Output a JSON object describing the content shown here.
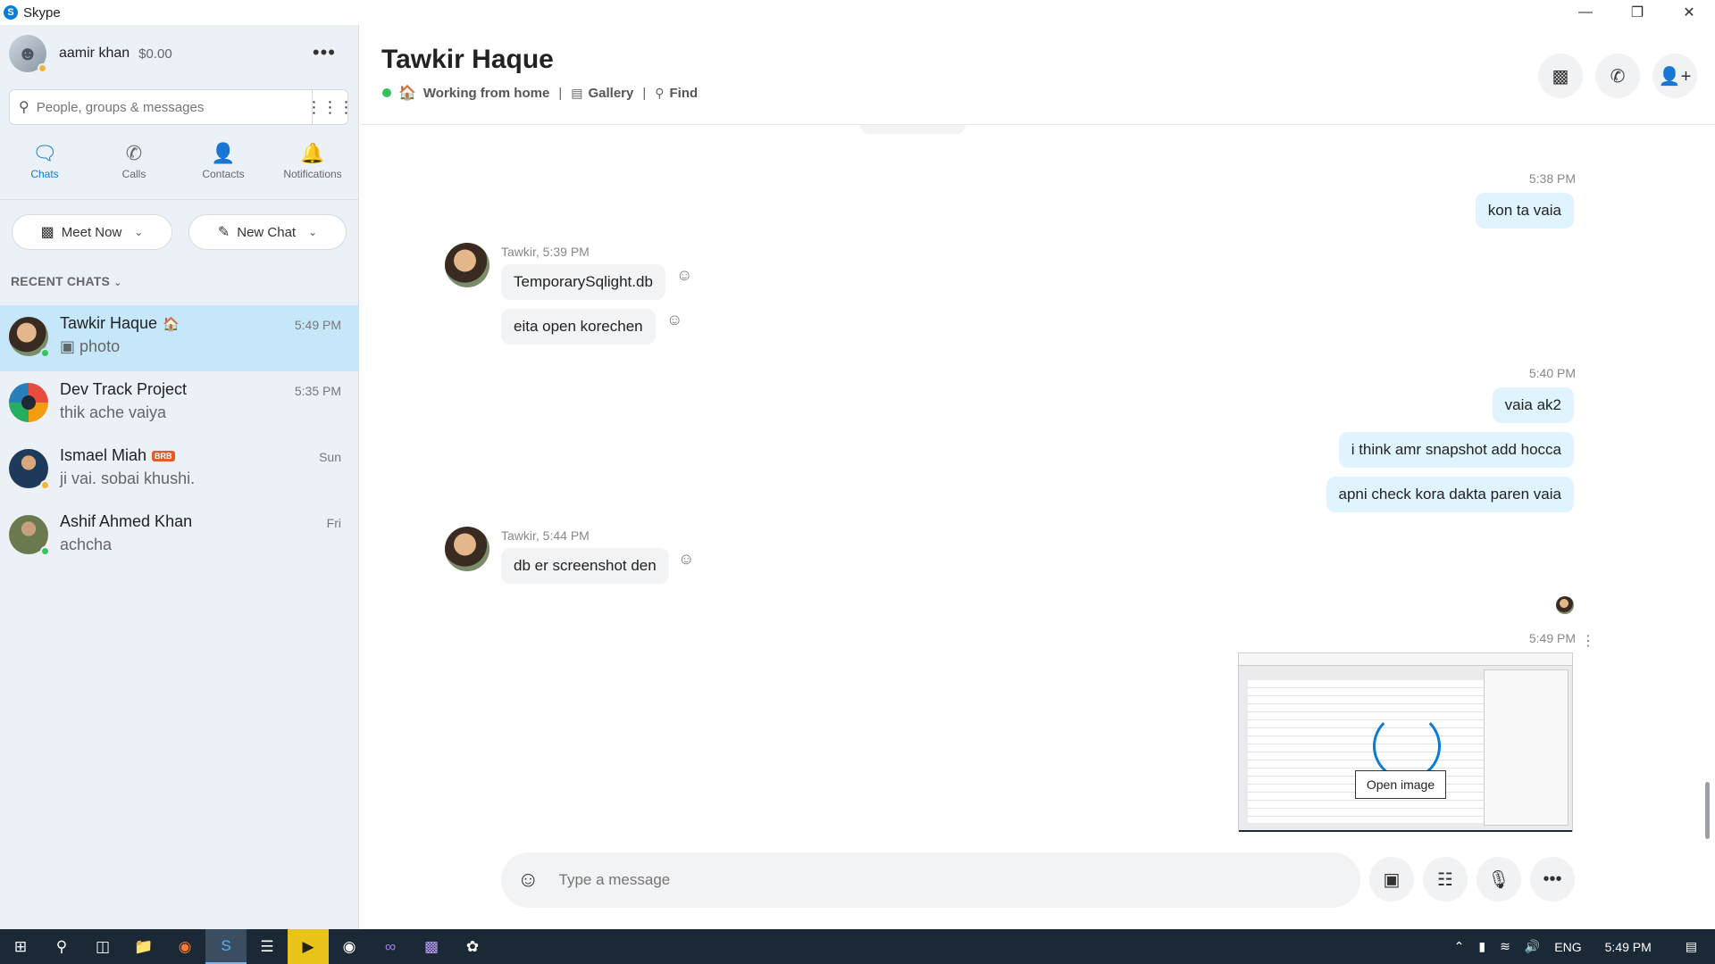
{
  "window": {
    "title": "Skype"
  },
  "profile": {
    "name": "aamir khan",
    "credit": "$0.00"
  },
  "search": {
    "placeholder": "People, groups & messages"
  },
  "nav": {
    "tabs": [
      {
        "label": "Chats",
        "icon": "chat-icon",
        "active": true
      },
      {
        "label": "Calls",
        "icon": "phone-icon"
      },
      {
        "label": "Contacts",
        "icon": "contacts-icon"
      },
      {
        "label": "Notifications",
        "icon": "bell-icon"
      }
    ]
  },
  "actions": {
    "meet_now": "Meet Now",
    "new_chat": "New Chat"
  },
  "recent_chats": {
    "header": "RECENT CHATS",
    "items": [
      {
        "name": "Tawkir Haque",
        "preview": "photo",
        "time": "5:49 PM",
        "status": "#35c45a"
      },
      {
        "name": "Dev Track Project",
        "preview": "thik ache vaiya",
        "time": "5:35 PM"
      },
      {
        "name": "Ismael Miah",
        "preview": "ji vai. sobai khushi.",
        "time": "Sun",
        "badge": "BRB",
        "status": "#f2b53a"
      },
      {
        "name": "Ashif Ahmed Khan",
        "preview": "achcha",
        "time": "Fri",
        "status": "#35c45a"
      }
    ]
  },
  "conversation": {
    "contact_name": "Tawkir Haque",
    "mood": "Working from home",
    "gallery": "Gallery",
    "find": "Find",
    "messages": {
      "ts1": "5:38 PM",
      "m1": "kon ta vaia",
      "sender1": "Tawkir, 5:39 PM",
      "m2": "TemporarySqlight.db",
      "m3": "eita open korechen",
      "ts2": "5:40 PM",
      "m4": "vaia ak2",
      "m5": "i think amr snapshot add hocca",
      "m6": "apni check kora dakta paren vaia",
      "sender2": "Tawkir, 5:44 PM",
      "m7": "db er screenshot den",
      "ts3": "5:49 PM",
      "open_image": "Open image"
    },
    "composer_placeholder": "Type a message"
  },
  "taskbar": {
    "lang": "ENG",
    "time": "5:49 PM"
  },
  "colors": {
    "accent": "#0a7cd6",
    "online": "#35c45a",
    "away": "#f2b53a",
    "selected": "#c6e7fa",
    "outgoing_bubble": "#e0f4ff"
  }
}
